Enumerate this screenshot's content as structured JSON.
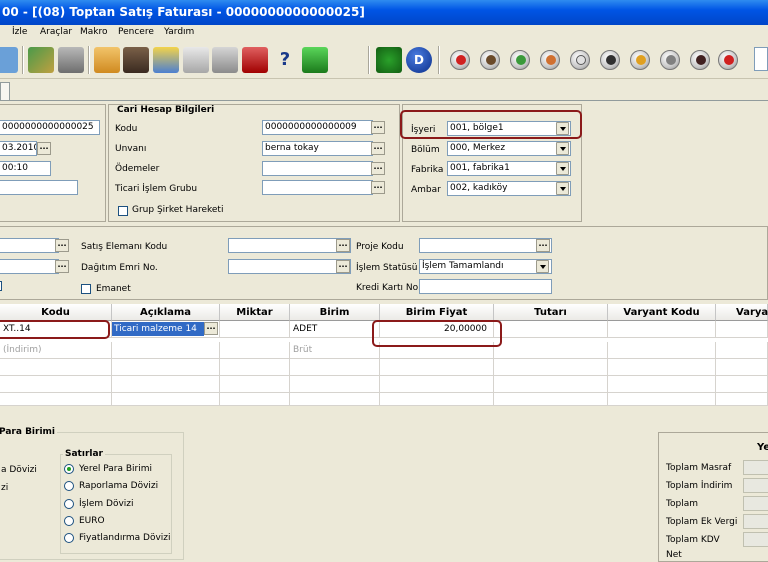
{
  "window": {
    "title": "00 - [(08) Toptan Satış Faturası - 0000000000000025]"
  },
  "menu": [
    "İzle",
    "Araçlar",
    "Makro",
    "Pencere",
    "Yardım"
  ],
  "header": {
    "doc_number": "0000000000000025",
    "date": "03.2010",
    "time": "00:10"
  },
  "cari": {
    "title": "Cari Hesap Bilgileri",
    "kodu_label": "Kodu",
    "kodu_value": "0000000000000009",
    "unvani_label": "Unvanı",
    "unvani_value": "berna tokay",
    "odemeler_label": "Ödemeler",
    "ticari_label": "Ticari İşlem Grubu",
    "grup_label": "Grup Şirket Hareketi"
  },
  "org": {
    "isyeri_label": "İşyeri",
    "isyeri_value": "001, bölge1",
    "bolum_label": "Bölüm",
    "bolum_value": "000, Merkez",
    "fabrika_label": "Fabrika",
    "fabrika_value": "001, fabrika1",
    "ambar_label": "Ambar",
    "ambar_value": "002, kadıköy"
  },
  "mid": {
    "satis_label": "Satış Elemanı Kodu",
    "dagitim_label": "Dağıtım Emri No.",
    "emanet_label": "Emanet",
    "proje_label": "Proje Kodu",
    "islem_label": "İşlem Statüsü",
    "islem_value": "İşlem Tamamlandı",
    "kredi_label": "Kredi Kartı No."
  },
  "grid": {
    "headers": [
      "Kodu",
      "Açıklama",
      "Miktar",
      "Birim",
      "Birim Fiyat",
      "Tutarı",
      "Varyant Kodu",
      "Varya"
    ],
    "row1": {
      "kodu": "XT..14",
      "aciklama": "Ticari malzeme 14",
      "birim": "ADET",
      "birim_fiyat": "20,00000"
    },
    "row2": {
      "kodu": "(İndirim)",
      "birim": "Brüt"
    }
  },
  "bottom": {
    "para_title": "Para Birimi",
    "para_items": [
      "a Dövizi",
      "zi"
    ],
    "satirlar_title": "Satırlar",
    "satirlar_items": [
      "Yerel Para Birimi",
      "Raporlama Dövizi",
      "İşlem Dövizi",
      "EURO",
      "Fiyatlandırma Dövizi"
    ],
    "totals_header": "Ye",
    "totals": [
      "Toplam Masraf",
      "Toplam İndirim",
      "Toplam",
      "Toplam Ek Vergi",
      "Toplam KDV",
      "Net"
    ]
  }
}
